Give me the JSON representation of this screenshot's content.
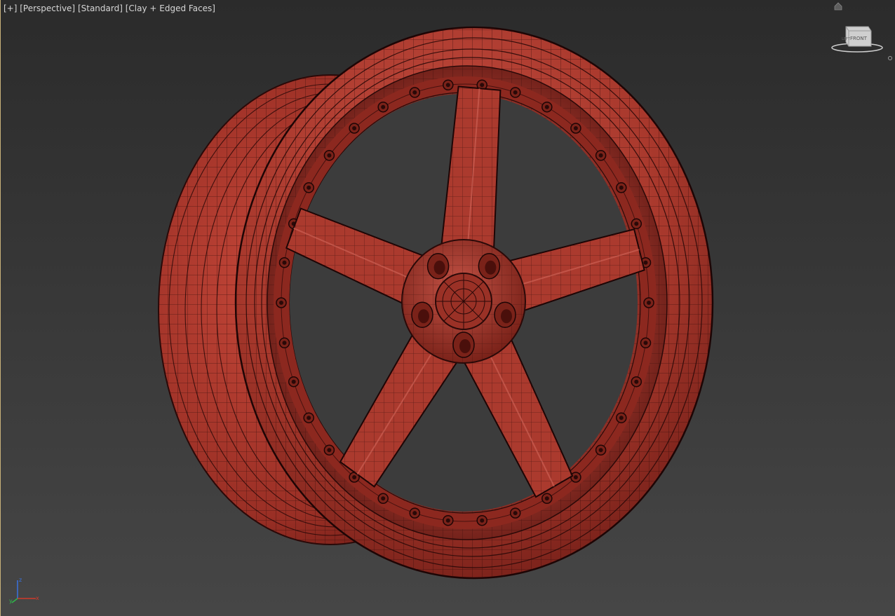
{
  "viewport": {
    "label_parts": [
      {
        "id": "plus",
        "text": "[+]"
      },
      {
        "id": "view",
        "text": "[Perspective]"
      },
      {
        "id": "shading-preset",
        "text": "[Standard]"
      },
      {
        "id": "display-mode",
        "text": "[Clay + Edged Faces]"
      }
    ],
    "background_top": "#2b2b2b",
    "background_bottom": "#464646",
    "border_color": "#c9b27a"
  },
  "model": {
    "description_icon": "rim-mesh",
    "clay_color": "#a8382c",
    "clay_shadow": "#6e1a14",
    "edge_color": "#2a0908",
    "spoke_count": 5,
    "lug_count": 5,
    "rim_bolt_count": 34
  },
  "viewcube": {
    "faces": {
      "front": "FRONT",
      "left": "LEFT"
    },
    "icon": "viewcube-icon",
    "home_icon": "home-icon"
  },
  "axis": {
    "x": "x",
    "y": "y",
    "z": "z",
    "x_color": "#d23a2a",
    "y_color": "#2fb84a",
    "z_color": "#3a72e0"
  }
}
